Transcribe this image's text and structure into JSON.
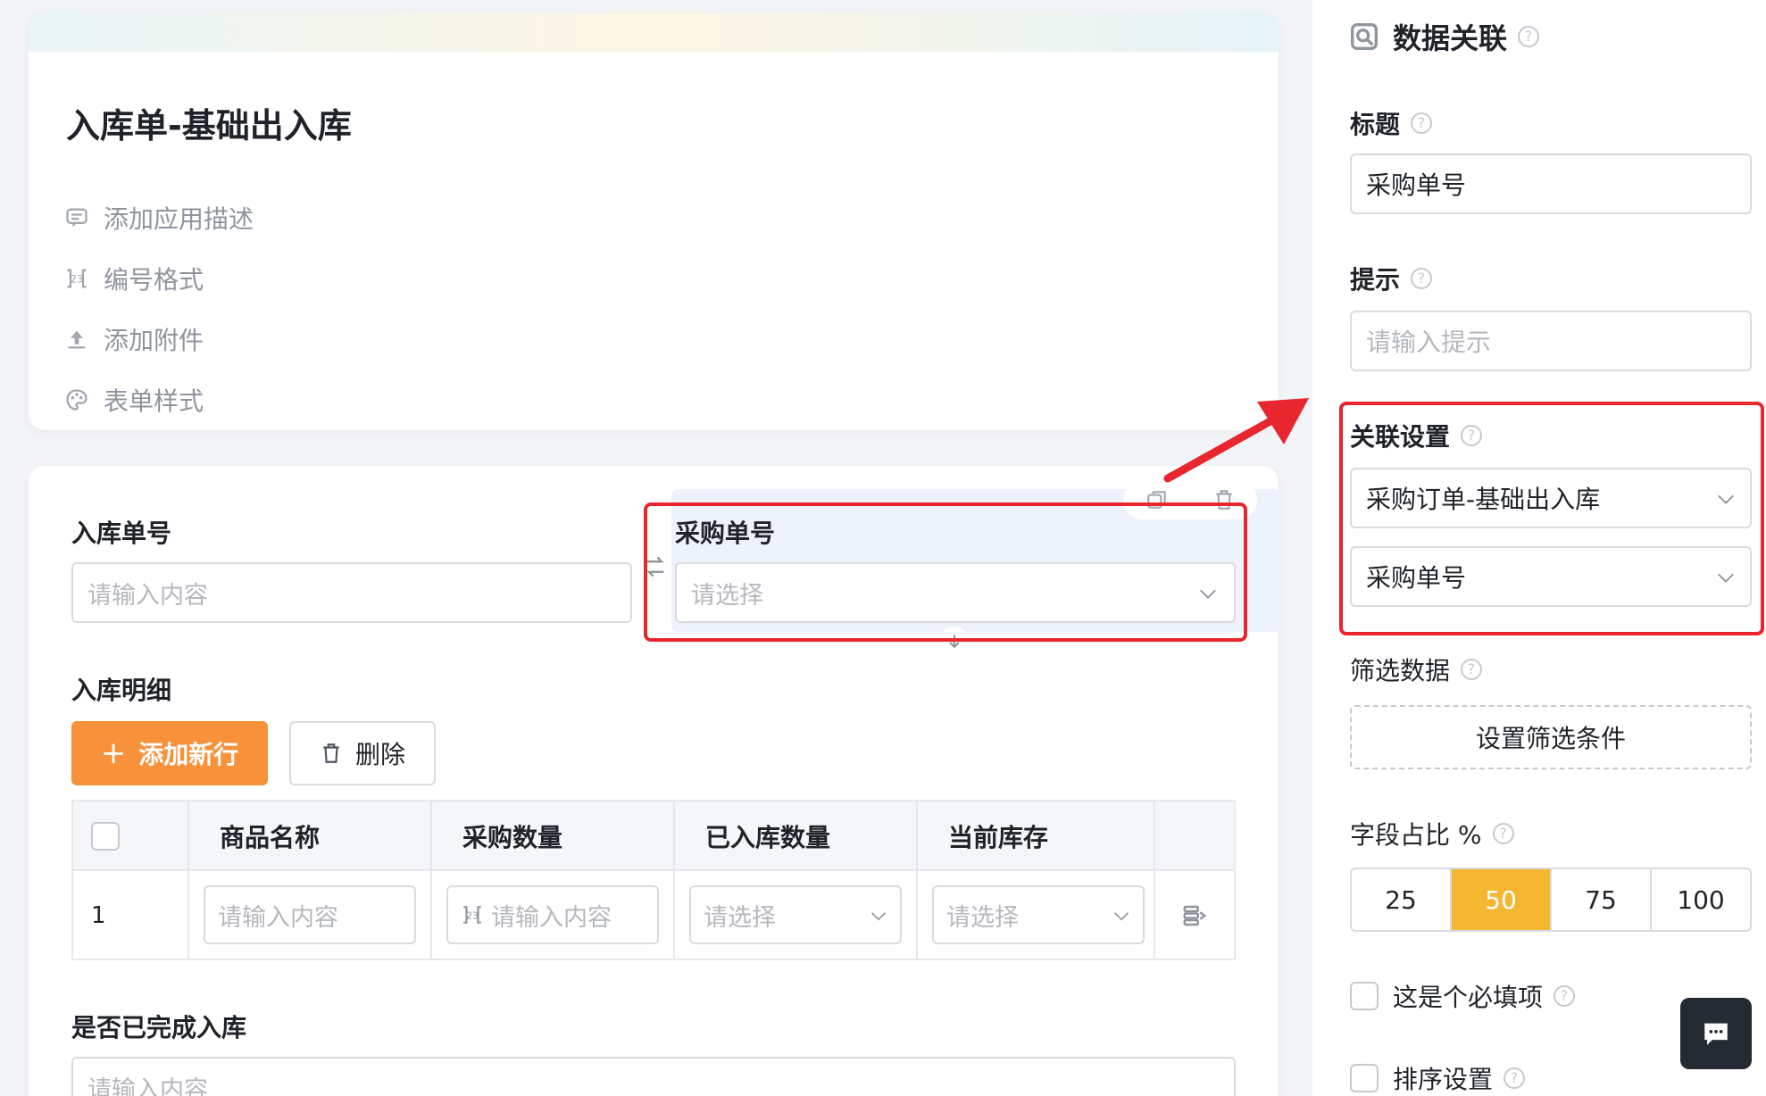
{
  "form": {
    "title": "入库单-基础出入库",
    "meta": [
      {
        "icon": "comment-icon",
        "label": "添加应用描述"
      },
      {
        "icon": "number-format-icon",
        "label": "编号格式"
      },
      {
        "icon": "upload-icon",
        "label": "添加附件"
      },
      {
        "icon": "palette-icon",
        "label": "表单样式"
      }
    ]
  },
  "fields": {
    "receipt_no": {
      "label": "入库单号",
      "placeholder": "请输入内容"
    },
    "purchase_no": {
      "label": "采购单号",
      "placeholder": "请选择"
    },
    "detail": {
      "label": "入库明细"
    },
    "done": {
      "label": "是否已完成入库",
      "placeholder": "请输入内容"
    }
  },
  "detail_actions": {
    "add_label": "添加新行",
    "delete_label": "删除"
  },
  "table": {
    "columns": [
      "商品名称",
      "采购数量",
      "已入库数量",
      "当前库存"
    ],
    "row": {
      "index": "1",
      "cells": [
        "请输入内容",
        "请输入内容",
        "请选择",
        "请选择"
      ]
    }
  },
  "panel": {
    "title": "数据关联",
    "label_title": "标题",
    "title_value": "采购单号",
    "label_hint": "提示",
    "hint_placeholder": "请输入提示",
    "label_relation": "关联设置",
    "relation_form": "采购订单-基础出入库",
    "relation_field": "采购单号",
    "label_filter": "筛选数据",
    "filter_button": "设置筛选条件",
    "label_width": "字段占比 %",
    "width_options": [
      "25",
      "50",
      "75",
      "100"
    ],
    "width_selected": "50",
    "required_label": "这是个必填项",
    "sort_label": "排序设置"
  },
  "colors": {
    "accent_orange": "#f7923a",
    "segment_active": "#f5b731",
    "highlight_red": "#e8262d",
    "selected_bg": "#eef2fd"
  }
}
